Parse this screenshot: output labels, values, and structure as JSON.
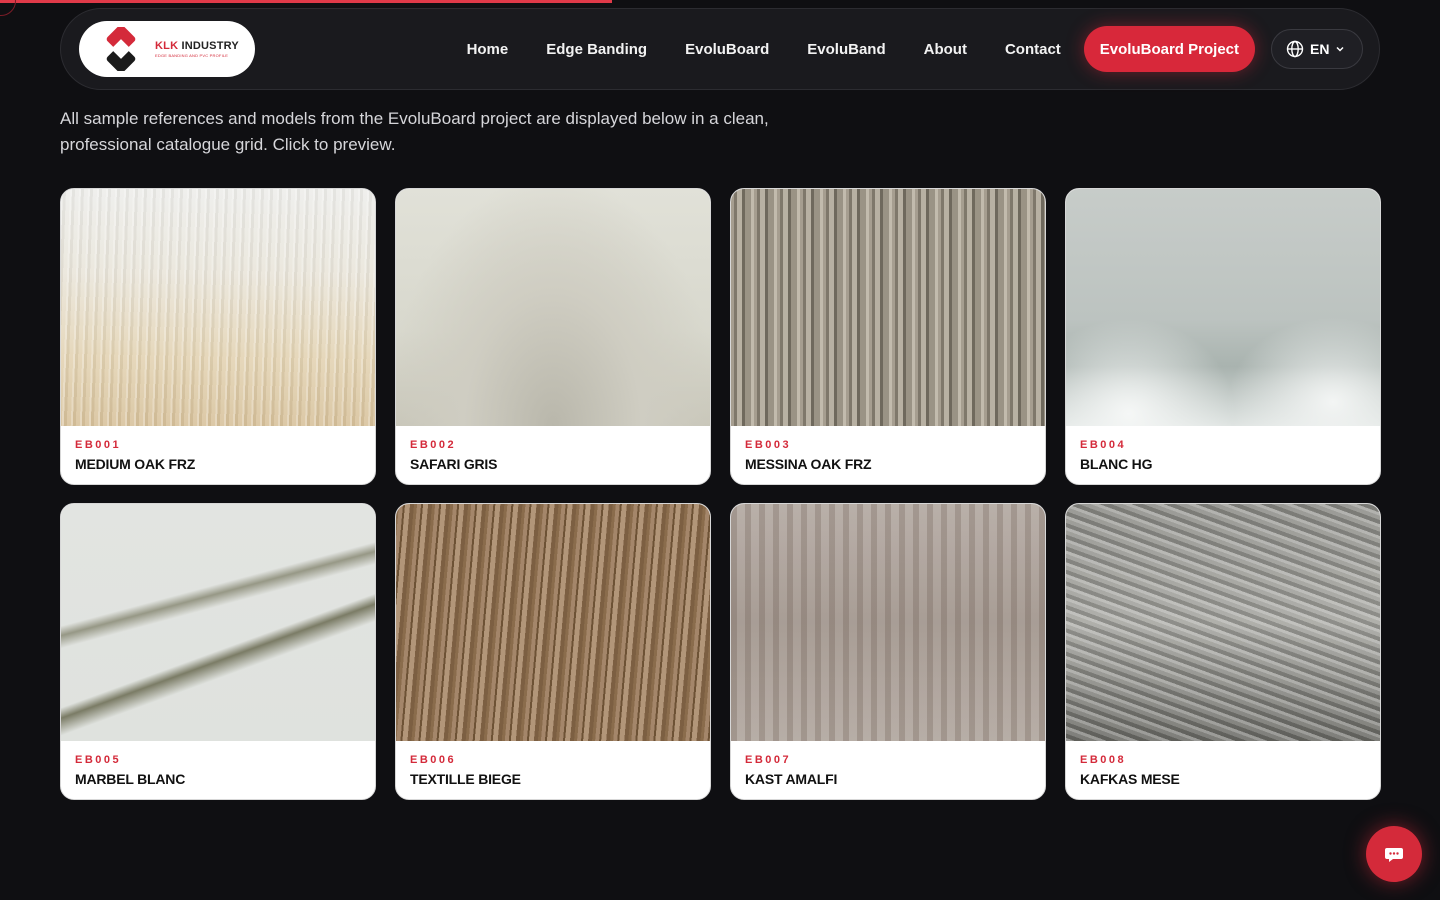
{
  "progress": {
    "value": 0.425,
    "color": "#e03a49"
  },
  "brand": {
    "name_red": "KLK",
    "name_rest": "INDUSTRY",
    "tagline": "EDGE BANDING AND PVC PROFILE",
    "accent": "#d42a3a"
  },
  "nav": {
    "links": [
      "Home",
      "Edge Banding",
      "EvoluBoard",
      "EvoluBand",
      "About",
      "Contact"
    ],
    "cta": "EvoluBoard Project",
    "language": {
      "code": "EN",
      "icon": "globe-icon",
      "chevron": "chevron-down-icon"
    }
  },
  "intro": {
    "text": "All sample references and models from the EvoluBoard project are displayed below in a clean, professional catalogue grid. Click to preview."
  },
  "products": [
    {
      "code": "EB001",
      "name": "MEDIUM OAK FRZ",
      "texture": "t1"
    },
    {
      "code": "EB002",
      "name": "SAFARI GRIS",
      "texture": "t2"
    },
    {
      "code": "EB003",
      "name": "MESSINA OAK FRZ",
      "texture": "t3"
    },
    {
      "code": "EB004",
      "name": "BLANC HG",
      "texture": "t4"
    },
    {
      "code": "EB005",
      "name": "MARBEL BLANC",
      "texture": "t5"
    },
    {
      "code": "EB006",
      "name": "TEXTILLE BIEGE",
      "texture": "t6"
    },
    {
      "code": "EB007",
      "name": "KAST AMALFI",
      "texture": "t7"
    },
    {
      "code": "EB008",
      "name": "KAFKAS MESE",
      "texture": "t8"
    }
  ],
  "chat": {
    "icon": "chat-bubble-icon"
  }
}
